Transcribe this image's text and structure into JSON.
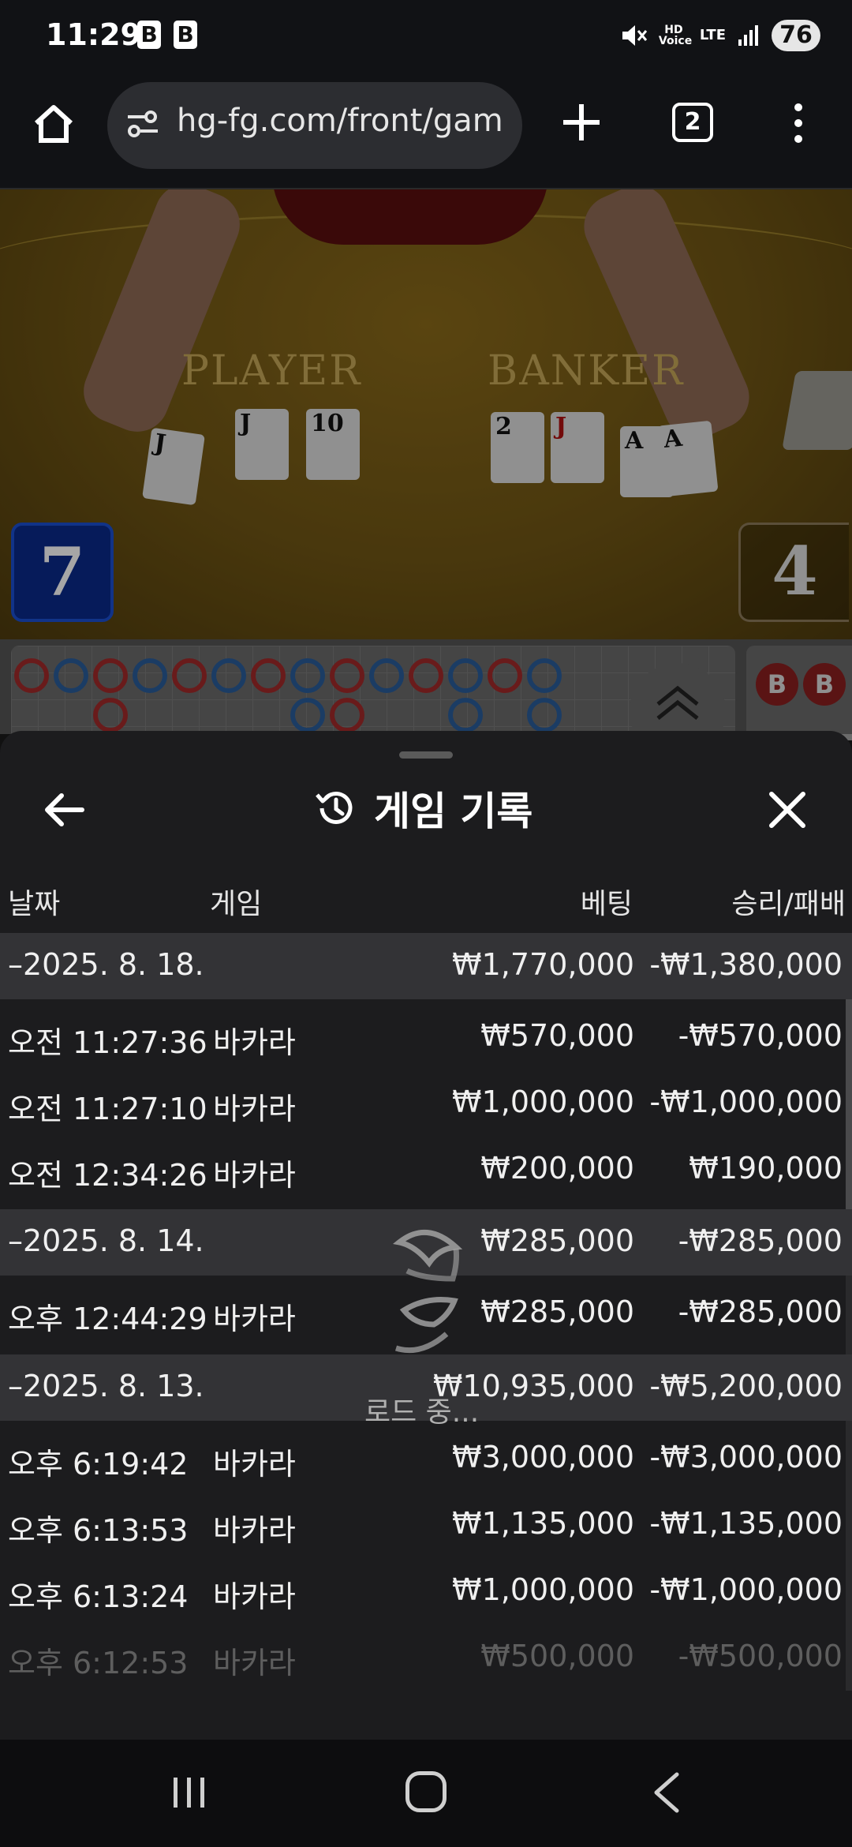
{
  "status": {
    "time": "11:29",
    "app_badges": [
      "B",
      "B"
    ],
    "hd_voice": "HD Voice",
    "network": "LTE",
    "battery": "76"
  },
  "browser": {
    "url": "hg-fg.com/front/gam",
    "tab_count": "2"
  },
  "game": {
    "player_label": "PLAYER",
    "banker_label": "BANKER",
    "player_score": "7",
    "banker_score": "4",
    "player_cards": [
      "J",
      "J",
      "10"
    ],
    "banker_cards": [
      "2",
      "J",
      "A",
      "A"
    ],
    "roadmap_letters": [
      "B",
      "B"
    ]
  },
  "sheet": {
    "title": "게임 기록",
    "columns": {
      "date": "날짜",
      "game": "게임",
      "bet": "베팅",
      "result": "승리/패배"
    },
    "rows": [
      {
        "type": "group",
        "date": "–2025. 8. 18.",
        "game": "",
        "bet": "₩1,770,000",
        "result": "-₩1,380,000"
      },
      {
        "type": "item",
        "date": "오전 11:27:36",
        "game": "바카라",
        "bet": "₩570,000",
        "result": "-₩570,000"
      },
      {
        "type": "item",
        "date": "오전 11:27:10",
        "game": "바카라",
        "bet": "₩1,000,000",
        "result": "-₩1,000,000"
      },
      {
        "type": "item",
        "date": "오전 12:34:26",
        "game": "바카라",
        "bet": "₩200,000",
        "result": "₩190,000"
      },
      {
        "type": "group",
        "date": "–2025. 8. 14.",
        "game": "",
        "bet": "₩285,000",
        "result": "-₩285,000"
      },
      {
        "type": "item",
        "date": "오후 12:44:29",
        "game": "바카라",
        "bet": "₩285,000",
        "result": "-₩285,000"
      },
      {
        "type": "group",
        "date": "–2025. 8. 13.",
        "game": "",
        "bet": "₩10,935,000",
        "result": "-₩5,200,000"
      },
      {
        "type": "item",
        "date": "오후 6:19:42",
        "game": "바카라",
        "bet": "₩3,000,000",
        "result": "-₩3,000,000"
      },
      {
        "type": "item",
        "date": "오후 6:13:53",
        "game": "바카라",
        "bet": "₩1,135,000",
        "result": "-₩1,135,000"
      },
      {
        "type": "item",
        "date": "오후 6:13:24",
        "game": "바카라",
        "bet": "₩1,000,000",
        "result": "-₩1,000,000"
      },
      {
        "type": "item",
        "date": "오후 6:12:53",
        "game": "바카라",
        "bet": "₩500,000",
        "result": "-₩500,000"
      }
    ],
    "loading_text": "로드 중..."
  },
  "icons": {
    "home": "home-icon",
    "site_settings": "tune-icon",
    "new_tab": "plus-icon",
    "menu": "more-vert-icon",
    "back": "arrow-left-icon",
    "history": "history-icon",
    "close": "close-icon",
    "nav_recents": "recents-icon",
    "nav_home": "home-nav-icon",
    "nav_back": "back-chevron-icon"
  }
}
